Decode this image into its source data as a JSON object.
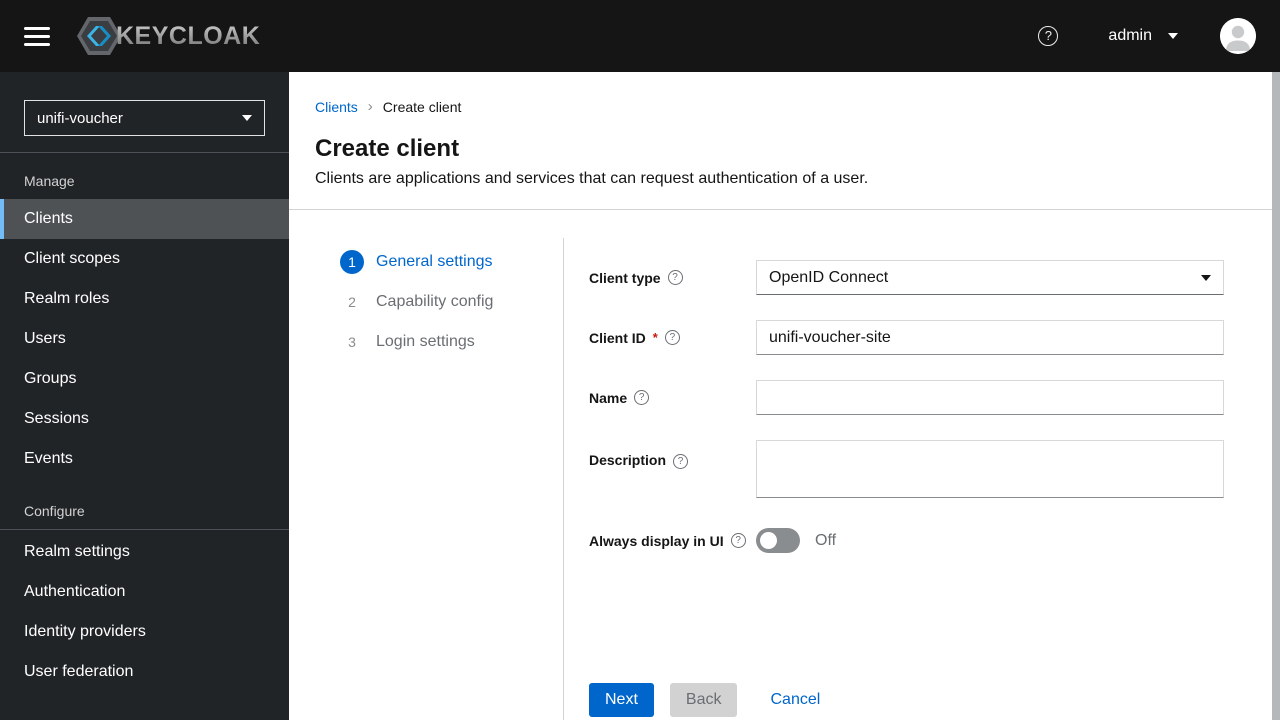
{
  "colors": {
    "primary": "#0066cc",
    "masthead_bg": "#151515",
    "sidebar_bg": "#212427",
    "sidebar_active_bg": "#4f5255",
    "sidebar_active_accent": "#73bcf7",
    "required_red": "#c9190b"
  },
  "masthead": {
    "brand": "KEYCLOAK",
    "username": "admin",
    "help_glyph": "?",
    "icons": [
      "menu-icon",
      "keycloak-logo",
      "question-circle-icon",
      "caret-down-icon",
      "avatar"
    ]
  },
  "sidebar": {
    "realm_selector": {
      "value": "unifi-voucher",
      "icon": "caret-down-icon"
    },
    "groups": [
      {
        "label": "Manage",
        "items": [
          {
            "label": "Clients",
            "active": true
          },
          {
            "label": "Client scopes",
            "active": false
          },
          {
            "label": "Realm roles",
            "active": false
          },
          {
            "label": "Users",
            "active": false
          },
          {
            "label": "Groups",
            "active": false
          },
          {
            "label": "Sessions",
            "active": false
          },
          {
            "label": "Events",
            "active": false
          }
        ]
      },
      {
        "label": "Configure",
        "items": [
          {
            "label": "Realm settings",
            "active": false
          },
          {
            "label": "Authentication",
            "active": false
          },
          {
            "label": "Identity providers",
            "active": false
          },
          {
            "label": "User federation",
            "active": false
          }
        ]
      }
    ]
  },
  "breadcrumb": {
    "separator": "›",
    "items": [
      {
        "label": "Clients",
        "type": "link"
      },
      {
        "label": "Create client",
        "type": "current"
      }
    ]
  },
  "page_header": {
    "title": "Create client",
    "subtitle": "Clients are applications and services that can request authentication of a user."
  },
  "wizard_steps": [
    {
      "number": "1",
      "label": "General settings",
      "active": true
    },
    {
      "number": "2",
      "label": "Capability config",
      "active": false
    },
    {
      "number": "3",
      "label": "Login settings",
      "active": false
    }
  ],
  "form": {
    "help_glyph": "?",
    "client_type": {
      "label": "Client type",
      "value": "OpenID Connect",
      "control": "select"
    },
    "client_id": {
      "label": "Client ID",
      "required_marker": "*",
      "value": "unifi-voucher-site",
      "control": "text-input"
    },
    "name": {
      "label": "Name",
      "value": "",
      "control": "text-input"
    },
    "description": {
      "label": "Description",
      "value": "",
      "control": "textarea"
    },
    "always_display": {
      "label": "Always display in UI",
      "state_label": "Off",
      "state": "off",
      "control": "toggle"
    }
  },
  "actions": {
    "next": "Next",
    "back": "Back",
    "cancel": "Cancel"
  }
}
